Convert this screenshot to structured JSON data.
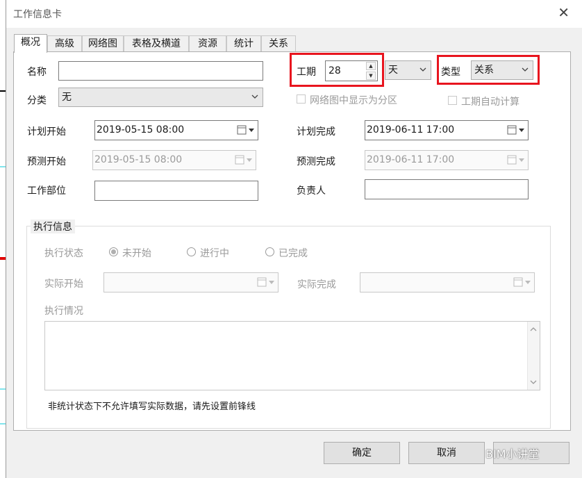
{
  "window": {
    "title": "工作信息卡",
    "close_glyph": "✕"
  },
  "tabs": [
    {
      "label": "概况",
      "active": true
    },
    {
      "label": "高级"
    },
    {
      "label": "网络图"
    },
    {
      "label": "表格及横道"
    },
    {
      "label": "资源"
    },
    {
      "label": "统计"
    },
    {
      "label": "关系"
    }
  ],
  "form": {
    "name_label": "名称",
    "name_value": "",
    "category_label": "分类",
    "category_value": "无",
    "duration_label": "工期",
    "duration_value": "28",
    "duration_unit": "天",
    "type_label": "类型",
    "type_value": "关系",
    "show_subarea_label": "网络图中显示为分区",
    "show_subarea_checked": false,
    "auto_calc_label": "工期自动计算",
    "auto_calc_checked": false,
    "plan_start_label": "计划开始",
    "plan_start_value": "2019-05-15 08:00",
    "plan_finish_label": "计划完成",
    "plan_finish_value": "2019-06-11 17:00",
    "forecast_start_label": "预测开始",
    "forecast_start_value": "2019-05-15 08:00",
    "forecast_finish_label": "预测完成",
    "forecast_finish_value": "2019-06-11 17:00",
    "work_part_label": "工作部位",
    "work_part_value": "",
    "owner_label": "负责人",
    "owner_value": ""
  },
  "execution": {
    "group_title": "执行信息",
    "status_label": "执行状态",
    "statuses": [
      {
        "label": "未开始",
        "selected": true
      },
      {
        "label": "进行中",
        "selected": false
      },
      {
        "label": "已完成",
        "selected": false
      }
    ],
    "actual_start_label": "实际开始",
    "actual_start_value": "",
    "actual_finish_label": "实际完成",
    "actual_finish_value": "",
    "situation_label": "执行情况",
    "note": "非统计状态下不允许填写实际数据，请先设置前锋线"
  },
  "buttons": {
    "ok": "确定",
    "cancel": "取消"
  },
  "watermark": "BIM小讲堂",
  "colors": {
    "highlight": "#e8141e",
    "grid_line": "#00c8d8",
    "accent_red": "#e00000"
  }
}
